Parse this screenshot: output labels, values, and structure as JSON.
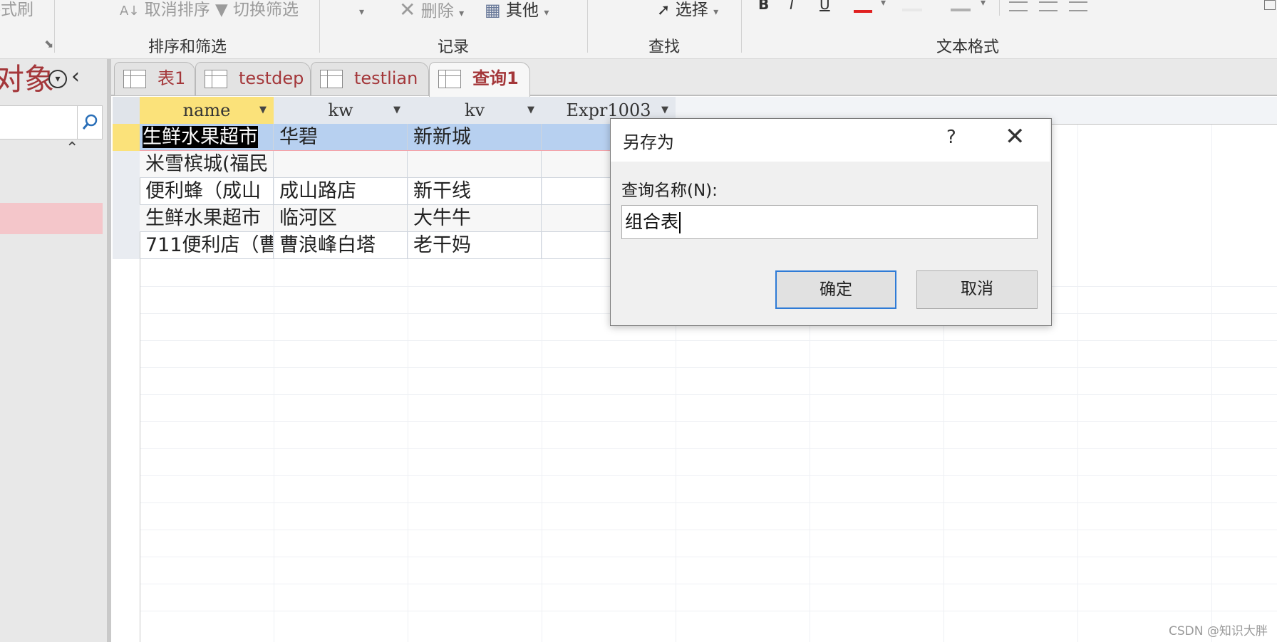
{
  "ribbon": {
    "items": {
      "format_painter": "格式刷",
      "clear_sort": "取消排序",
      "toggle_filter": "切换筛选",
      "delete": "删除",
      "more": "其他",
      "select": "选择",
      "bold": "B",
      "italic": "I",
      "underline": "U"
    },
    "groups": {
      "sort_filter": "排序和筛选",
      "records": "记录",
      "find": "查找",
      "text_format": "文本格式"
    }
  },
  "nav": {
    "title": "对象"
  },
  "tabs": [
    {
      "label": "表1"
    },
    {
      "label": "testdep"
    },
    {
      "label": "testlian"
    },
    {
      "label": "查询1"
    }
  ],
  "datasheet": {
    "columns": [
      "name",
      "kw",
      "kv",
      "Expr1003"
    ],
    "rows": [
      [
        "生鲜水果超市",
        "华碧",
        "新新城",
        ""
      ],
      [
        "米雪槟城(福民",
        "",
        "",
        ""
      ],
      [
        "便利蜂（成山",
        "成山路店",
        "新干线",
        ""
      ],
      [
        "生鲜水果超市",
        "临河区",
        "大牛牛",
        ""
      ],
      [
        "711便利店（曹",
        "曹浪峰白塔",
        "老干妈",
        ""
      ]
    ]
  },
  "dialog": {
    "title": "另存为",
    "help": "?",
    "label": "查询名称(N):",
    "input_value": "组合表",
    "ok": "确定",
    "cancel": "取消"
  },
  "watermark": "CSDN @知识大胖",
  "colors": {
    "accent": "#a4373a",
    "selected_row": "#b7d0f0",
    "selected_header": "#fbe27a"
  }
}
